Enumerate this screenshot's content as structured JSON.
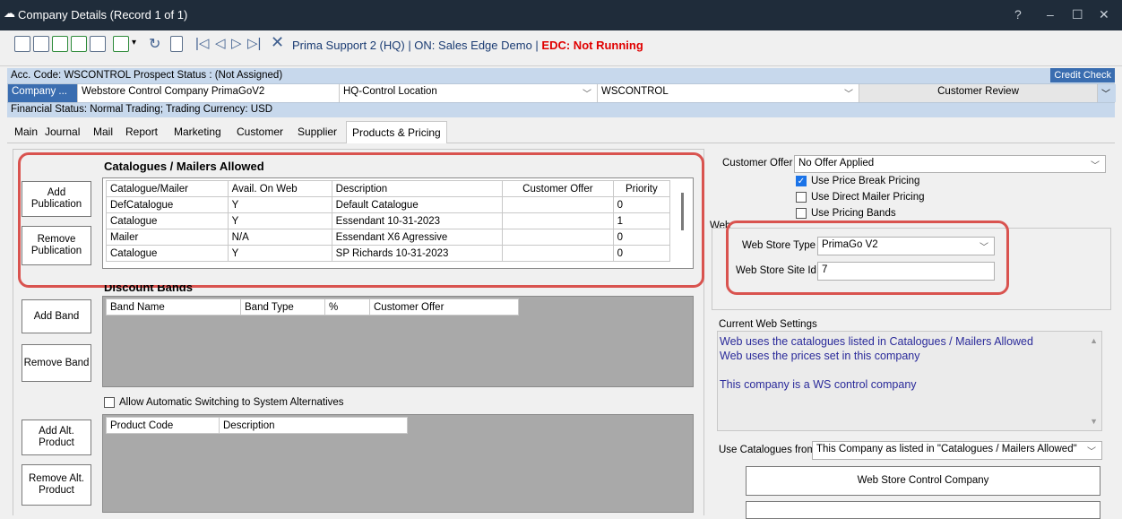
{
  "window": {
    "title": "Company Details  (Record 1 of 1)",
    "controls": [
      "?",
      "–",
      "☐",
      "✕"
    ]
  },
  "toolbar": {
    "connection": "Prima Support 2 (HQ) | ON: Sales Edge Demo | ",
    "edc": "EDC: Not Running"
  },
  "header": {
    "row1": "Acc. Code: WSCONTROL  Prospect Status : (Not Assigned)",
    "credit_check": "Credit Check",
    "company_button": "Company ...",
    "company_name": "Webstore Control Company PrimaGoV2",
    "location": "HQ-Control Location",
    "code": "WSCONTROL",
    "review": "Customer Review",
    "row3": "Financial Status: Normal Trading; Trading Currency: USD"
  },
  "tabs": [
    "Main",
    "Journal",
    "Mail",
    "Report",
    "Marketing",
    "Customer",
    "Supplier",
    "Products & Pricing"
  ],
  "catalogues": {
    "title": "Catalogues / Mailers Allowed",
    "add_button": "Add Publication",
    "remove_button": "Remove Publication",
    "columns": [
      "Catalogue/Mailer",
      "Avail. On Web",
      "Description",
      "Customer Offer",
      "Priority"
    ],
    "rows": [
      [
        "DefCatalogue",
        "Y",
        "Default Catalogue",
        "",
        "0"
      ],
      [
        "Catalogue",
        "Y",
        "Essendant 10-31-2023",
        "",
        "1"
      ],
      [
        "Mailer",
        "N/A",
        "Essendant X6 Agressive",
        "",
        "0"
      ],
      [
        "Catalogue",
        "Y",
        "SP Richards 10-31-2023",
        "",
        "0"
      ]
    ]
  },
  "discount": {
    "title": "Discount Bands",
    "add_button": "Add Band",
    "remove_button": "Remove Band",
    "columns": [
      "Band Name",
      "Band Type",
      "%",
      "Customer Offer"
    ]
  },
  "alternatives": {
    "checkbox_label": "Allow Automatic Switching to System Alternatives",
    "add_button": "Add Alt. Product",
    "remove_button": "Remove Alt. Product",
    "columns": [
      "Product Code",
      "Description"
    ]
  },
  "pricing": {
    "offer_label": "Customer Offer",
    "offer_value": "No Offer Applied",
    "price_break": "Use Price Break Pricing",
    "direct_mailer": "Use Direct Mailer Pricing",
    "pricing_bands": "Use Pricing Bands"
  },
  "web": {
    "group_label": "Web",
    "store_type_label": "Web Store Type",
    "store_type_value": "PrimaGo V2",
    "site_id_label": "Web Store Site Id",
    "site_id_value": "7",
    "settings_label": "Current Web Settings",
    "settings_lines": [
      "Web uses the catalogues listed in Catalogues / Mailers Allowed",
      "Web uses the prices set in this company",
      "",
      "This company is a WS control company"
    ],
    "use_catalogues_label": "Use Catalogues from",
    "use_catalogues_value": "This Company as listed in \"Catalogues / Mailers Allowed\"",
    "control_company_button": "Web Store Control Company"
  }
}
